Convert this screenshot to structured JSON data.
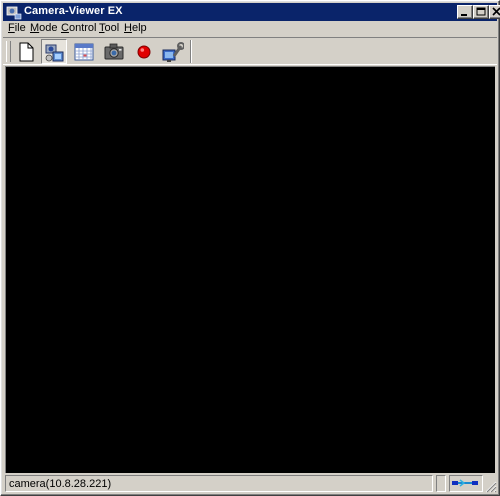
{
  "window": {
    "title": "Camera-Viewer EX",
    "controls": {
      "minimize": "minimize",
      "maximize": "maximize",
      "close": "close"
    }
  },
  "menu": {
    "items": [
      {
        "label": "File",
        "mnemonic": "F",
        "rest": "ile"
      },
      {
        "label": "Mode",
        "mnemonic": "M",
        "rest": "ode"
      },
      {
        "label": "Control",
        "mnemonic": "C",
        "rest": "ontrol"
      },
      {
        "label": "Tool",
        "mnemonic": "T",
        "rest": "ool"
      },
      {
        "label": "Help",
        "mnemonic": "H",
        "rest": "elp"
      }
    ]
  },
  "toolbar": {
    "buttons": [
      {
        "icon": "new-document-icon",
        "pressed": false
      },
      {
        "icon": "camera-list-icon",
        "pressed": true
      },
      {
        "icon": "calendar-icon",
        "pressed": false
      },
      {
        "icon": "snapshot-camera-icon",
        "pressed": false
      },
      {
        "icon": "record-icon",
        "pressed": false
      },
      {
        "icon": "settings-tools-icon",
        "pressed": false
      }
    ]
  },
  "status": {
    "text": "camera(10.8.28.221)",
    "connection_icon": "network-connection-icon"
  },
  "colors": {
    "titlebar": "#0a246a",
    "viewport": "#000000",
    "chrome": "#d4d0c8",
    "record": "#e00000"
  }
}
